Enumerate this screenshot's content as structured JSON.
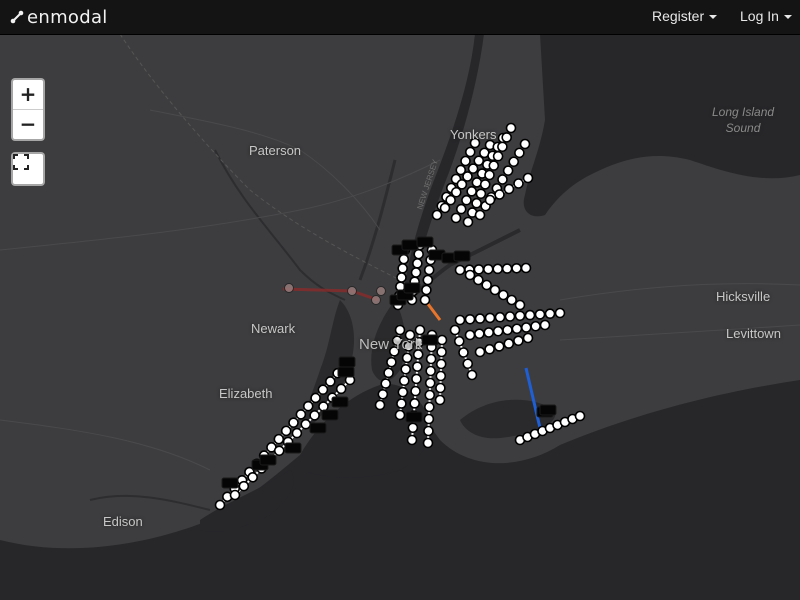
{
  "navbar": {
    "brand": "enmodal",
    "register_label": "Register",
    "login_label": "Log In"
  },
  "map_controls": {
    "zoom_in": "+",
    "zoom_out": "−"
  },
  "map_labels": {
    "yonkers": "Yonkers",
    "paterson": "Paterson",
    "newark": "Newark",
    "elizabeth": "Elizabeth",
    "edison": "Edison",
    "hicksville": "Hicksville",
    "levittown": "Levittown",
    "new_york": "New York",
    "long_island_sound_1": "Long Island",
    "long_island_sound_2": "Sound"
  },
  "colors": {
    "navbar": "#141414",
    "land": "#3c3c3e",
    "water": "#262628",
    "station": "#ffffff",
    "station_stroke": "#000000",
    "blue_line": "#1f5fd6",
    "path_line": "#8b2b2b"
  },
  "icons": [
    "enmodal-logo-icon",
    "caret-down-icon",
    "fullscreen-icon"
  ]
}
